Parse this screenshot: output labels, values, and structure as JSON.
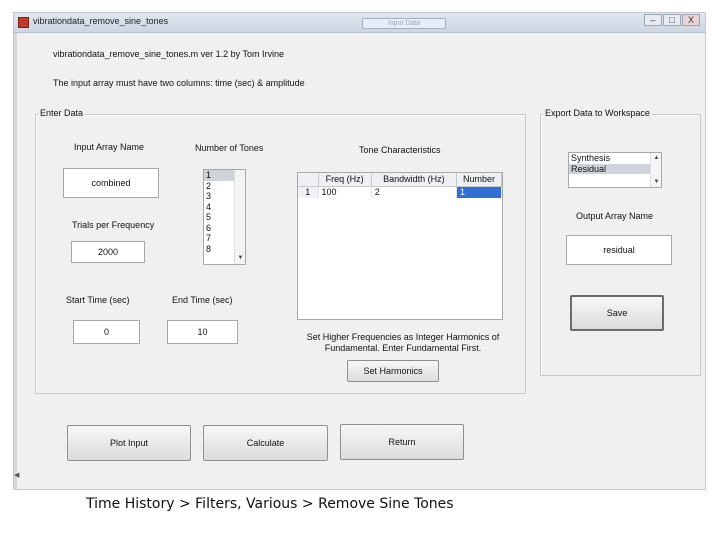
{
  "window": {
    "title": "vibrationdata_remove_sine_tones",
    "ghost_button": "Input Data",
    "minimize_icon": "minimize-icon",
    "maximize_icon": "maximize-icon",
    "close_icon": "close-icon",
    "close_glyph": "X"
  },
  "header": {
    "line1": "vibrationdata_remove_sine_tones.m   ver 1.2   by Tom Irvine",
    "line2": "The input array must have two columns:  time (sec) & amplitude"
  },
  "enter_data": {
    "panel_title": "Enter Data",
    "input_array_label": "Input Array Name",
    "input_array_value": "combined",
    "trials_label": "Trials per Frequency",
    "trials_value": "2000",
    "tones_label": "Number of Tones",
    "tones_options": [
      "1",
      "2",
      "3",
      "4",
      "5",
      "6",
      "7",
      "8"
    ],
    "tones_selected": "1",
    "start_time_label": "Start Time (sec)",
    "start_time_value": "0",
    "end_time_label": "End Time (sec)",
    "end_time_value": "10",
    "tone_char_label": "Tone Characteristics",
    "table_columns": [
      "Freq (Hz)",
      "Bandwidth (Hz)",
      "Number"
    ],
    "table_rows": [
      {
        "row": "1",
        "freq": "100",
        "bandwidth": "2",
        "number": "1"
      }
    ],
    "harmonics_note": "Set Higher Frequencies as Integer Harmonics of Fundamental.  Enter Fundamental First.",
    "harmonics_button": "Set Harmonics"
  },
  "export": {
    "panel_title": "Export Data to Workspace",
    "options": [
      "Synthesis",
      "Residual"
    ],
    "selected": "Residual",
    "output_label": "Output Array Name",
    "output_value": "residual",
    "save_button": "Save"
  },
  "actions": {
    "plot_input": "Plot Input",
    "calculate": "Calculate",
    "return": "Return"
  },
  "caption": "Time History > Filters, Various >  Remove Sine Tones"
}
